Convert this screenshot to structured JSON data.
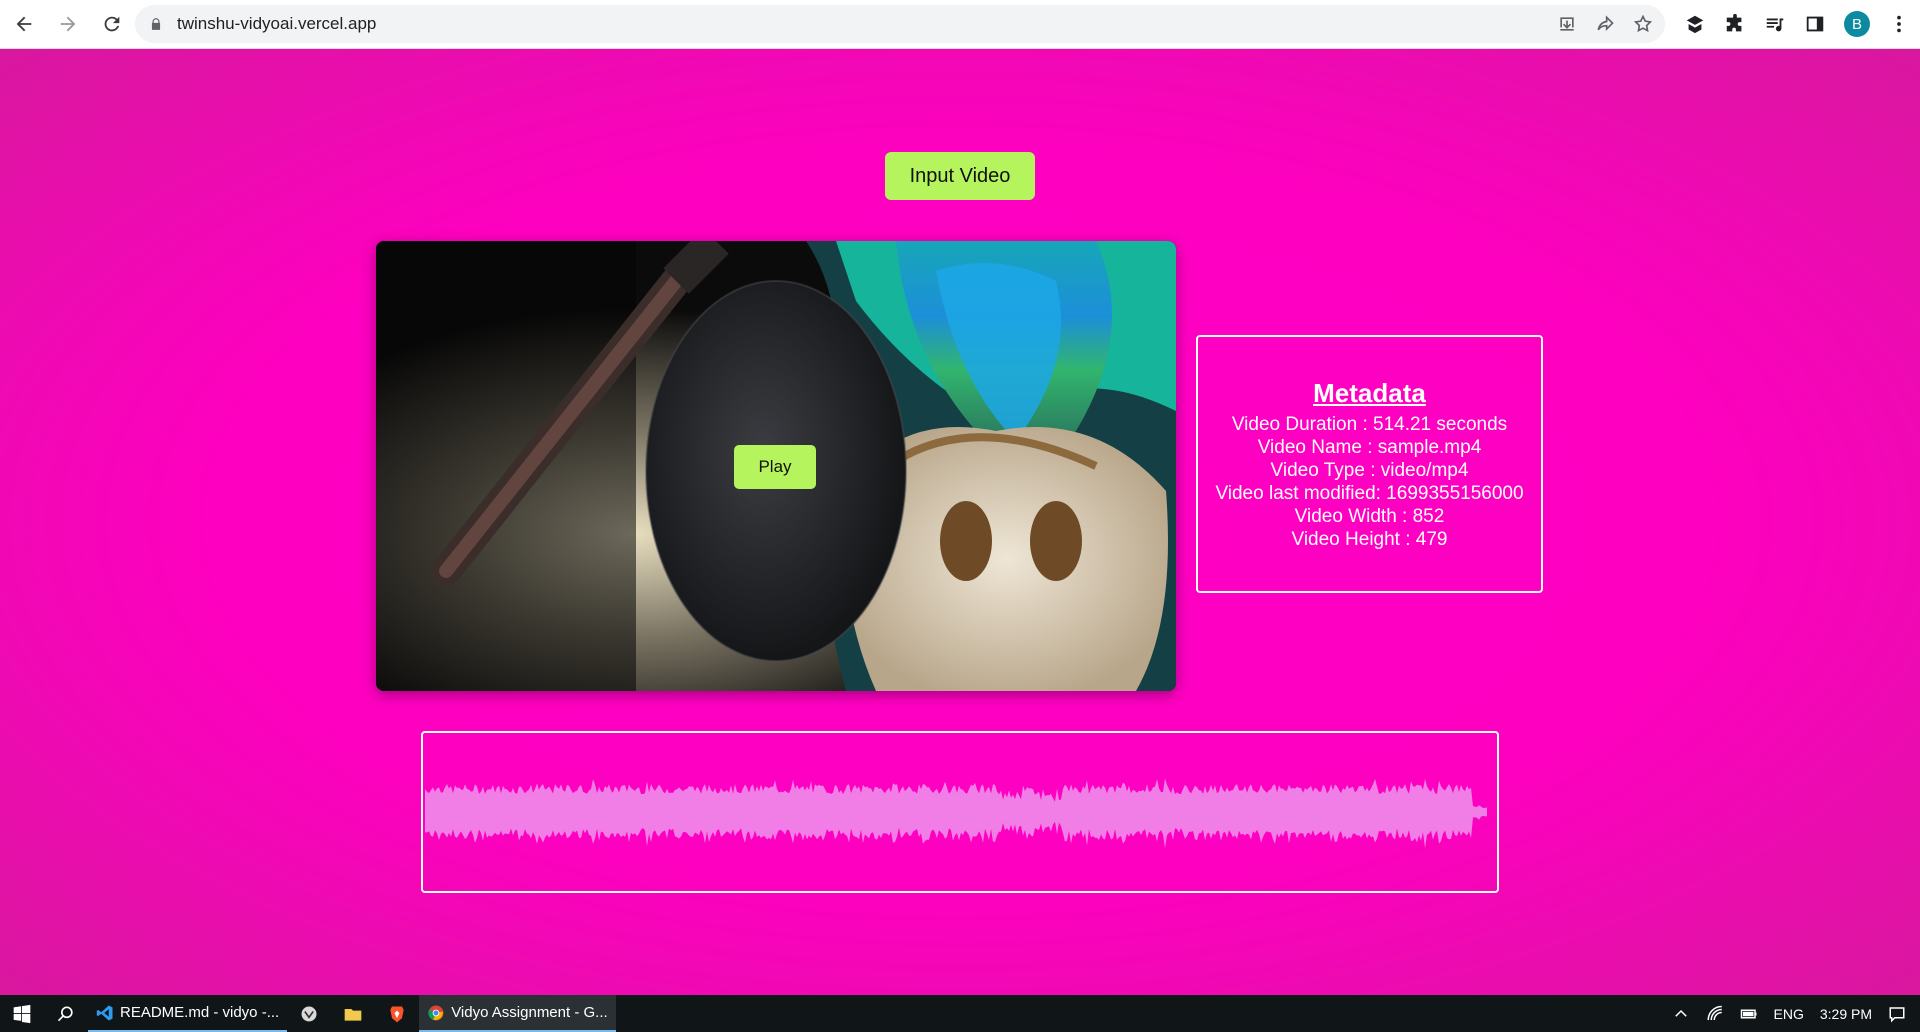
{
  "browser": {
    "url": "twinshu-vidyoai.vercel.app",
    "profile_initial": "B",
    "icons": [
      "back-icon",
      "forward-icon",
      "reload-icon",
      "lock-icon",
      "install-icon",
      "share-icon",
      "star-icon",
      "extension-icon",
      "puzzle-icon",
      "media-icon",
      "sidepanel-icon",
      "menu-icon"
    ]
  },
  "page": {
    "input_video_label": "Input Video",
    "play_label": "Play",
    "metadata": {
      "title": "Metadata",
      "lines": [
        "Video Duration : 514.21 seconds",
        "Video Name : sample.mp4",
        "Video Type : video/mp4",
        "Video last modified: 1699355156000",
        "Video Width : 852",
        "Video Height : 479"
      ]
    },
    "colors": {
      "background": "#ff00c4",
      "button": "#b5f45c",
      "waveform": "#f07ee6"
    }
  },
  "taskbar": {
    "apps": [
      {
        "label": "README.md - vidyo -...",
        "icon": "vscode-icon"
      },
      {
        "label": "Vidyo Assignment - G...",
        "icon": "chrome-icon"
      }
    ],
    "pinned_icons": [
      "start-icon",
      "search-icon",
      "app-icon",
      "folder-icon",
      "brave-icon"
    ],
    "language": "ENG",
    "time": "3:29 PM"
  }
}
